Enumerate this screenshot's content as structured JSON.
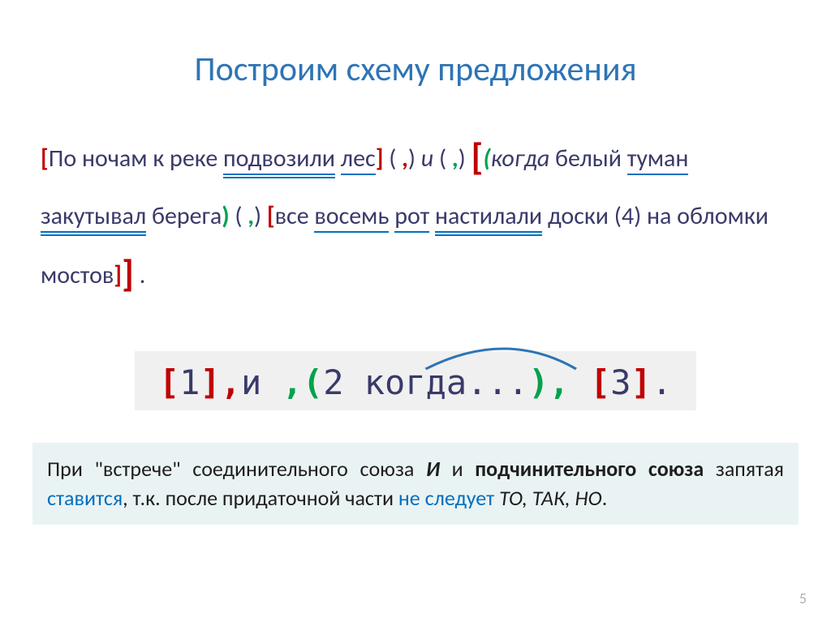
{
  "title": "Построим схему предложения",
  "s": {
    "brL1": "[",
    "p1": "По ночам к реке ",
    "verb1": "подвозили",
    "sp1": " ",
    "subj1": "лес",
    "brR1": "]",
    "sp2": " ( ",
    "comma1": ",",
    "close1": ") ",
    "i_it": "и ",
    "open2": "( ",
    "comma2": ",",
    "close2": ") ",
    "bigL": "[",
    "gL": "(",
    "kogda": "когда",
    "line2a": "белый",
    "sp3": " ",
    "subj2": "туман",
    "sp4": " ",
    "verb2": "закутывал",
    "sp5": " ",
    "obj2": "берега",
    "gR": ")",
    "open3": " ( ",
    "comma3": ",",
    "close3": ") ",
    "brL3": "[",
    "p3a": "все ",
    "subj3": "восемь",
    "subj3b": "рот",
    "sp6": " ",
    "verb3": "настилали",
    "p3b": " доски (4) на обломки мостов",
    "brR3": "]",
    "bigR": "]",
    "sp7": " ",
    "period": "."
  },
  "f": {
    "brL1": "[",
    "n1": "1",
    "brR1": "]",
    "c1": ",",
    "and": "и ",
    "c2": ",",
    "pL": "(",
    "mid": "2 когда...",
    "pR": ")",
    "c3": ", ",
    "brL3": "[",
    "n3": "3",
    "brR3": "]",
    "end": "."
  },
  "note": {
    "p1": "При \"встрече\" соединительного союза ",
    "and": "И",
    "p2": " и ",
    "sub": "подчини­тельного союза",
    "p3": " запятая ",
    "put": "ставится",
    "p4": ", т.к. после придаточной части ",
    "not": "не следует",
    "p5": " ",
    "list": "ТО, ТАК, НО",
    "p6": "."
  },
  "page": "5"
}
